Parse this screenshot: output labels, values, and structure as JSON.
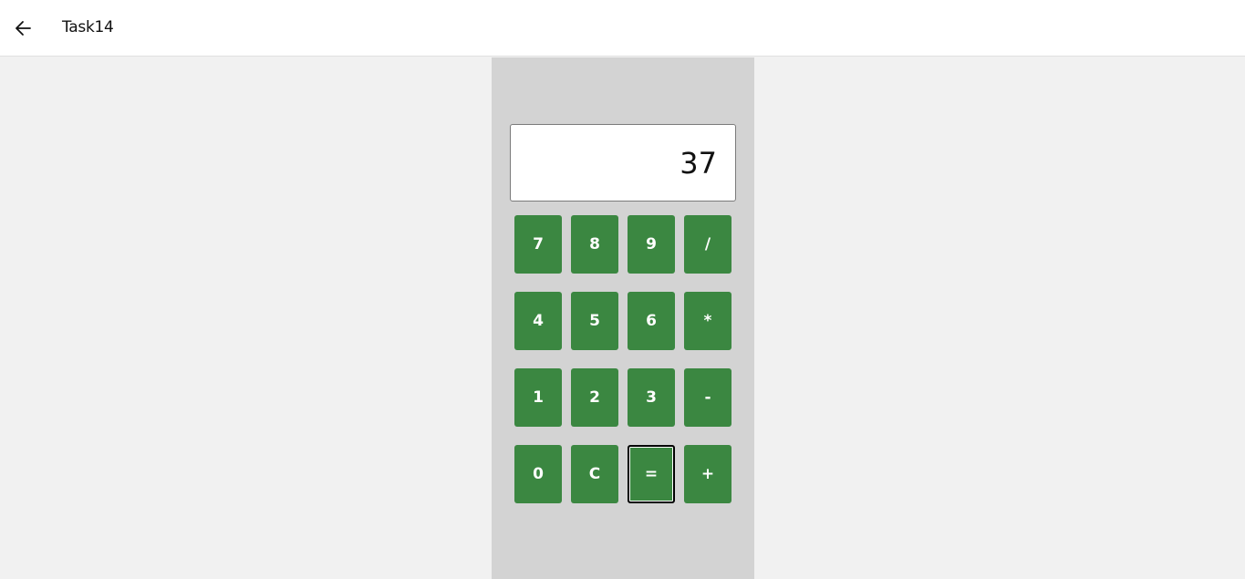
{
  "window": {
    "title": "Task14",
    "back_icon": "arrow-left-icon"
  },
  "calculator": {
    "display_value": "37",
    "keys": [
      [
        "7",
        "8",
        "9",
        "/"
      ],
      [
        "4",
        "5",
        "6",
        "*"
      ],
      [
        "1",
        "2",
        "3",
        "-"
      ],
      [
        "0",
        "C",
        "=",
        "+"
      ]
    ],
    "focused_key": "=",
    "colors": {
      "key_bg": "#3b8741",
      "panel_bg": "#d3d3d3",
      "page_bg": "#f1f1f1"
    }
  }
}
